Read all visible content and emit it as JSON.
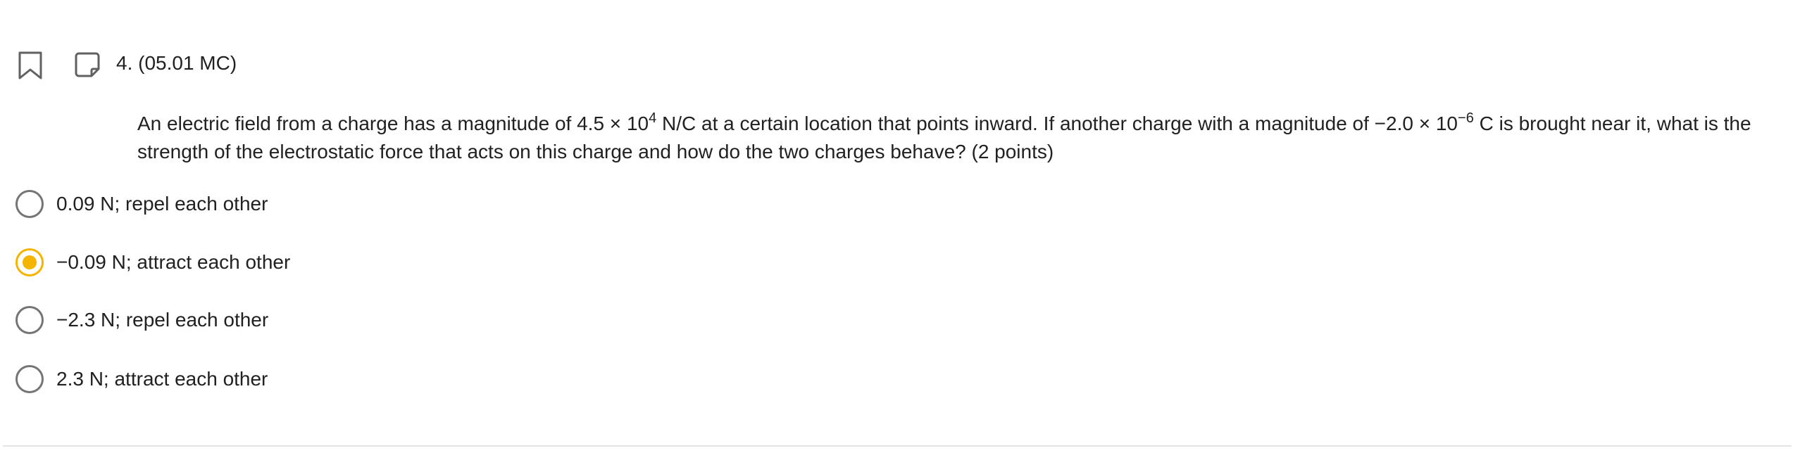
{
  "question": {
    "number": "4. (05.01 MC)",
    "text_parts": {
      "part1": "An electric field from a charge has a magnitude of 4.5 × 10",
      "exp1": "4",
      "part2": " N/C at a certain location that points inward. If another charge with a magnitude of −2.0 × 10",
      "exp2": "−6",
      "part3": " C is brought near it, what is the strength of the electrostatic force that acts on this charge and how do the two charges behave? (2 points)"
    },
    "options": [
      {
        "label": "0.09 N; repel each other",
        "selected": false
      },
      {
        "label": "−0.09 N; attract each other",
        "selected": true
      },
      {
        "label": "−2.3 N; repel each other",
        "selected": false
      },
      {
        "label": "2.3 N; attract each other",
        "selected": false
      }
    ]
  },
  "icons": {
    "bookmark": "bookmark-icon",
    "note": "note-icon"
  },
  "colors": {
    "selected_accent": "#f4b400",
    "radio_border": "#757575",
    "text": "#212121",
    "divider": "#e4e4e4"
  }
}
